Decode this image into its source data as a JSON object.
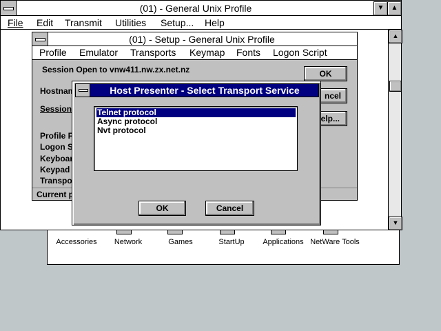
{
  "program_manager": {
    "groups": [
      {
        "label": "Accessories"
      },
      {
        "label": "Network"
      },
      {
        "label": "Games"
      },
      {
        "label": "StartUp"
      },
      {
        "label": "Applications"
      },
      {
        "label": "NetWare Tools"
      }
    ]
  },
  "main_window": {
    "title": "(01) - General Unix Profile",
    "menu": [
      "File",
      "Edit",
      "Transmit",
      "Utilities",
      "Setup...",
      "Help"
    ]
  },
  "setup_window": {
    "title": "(01) - Setup - General Unix Profile",
    "menu": [
      "Profile",
      "Emulator",
      "Transports",
      "Keymap",
      "Fonts",
      "Logon Script"
    ],
    "session_text": "Session Open to vnw411.nw.zx.net.nz",
    "fields": [
      "Hostnam",
      "Session",
      "Profile F",
      "Logon S",
      "Keyboar",
      "Keypad",
      "Transpo"
    ],
    "status": "Current p",
    "buttons": {
      "ok": "OK",
      "cancel": "ncel",
      "help": "elp..."
    }
  },
  "dialog": {
    "title": "Host Presenter - Select Transport Service",
    "options": [
      "Telnet protocol",
      "Async protocol",
      "Nvt protocol"
    ],
    "selected_index": 0,
    "ok_label": "OK",
    "cancel_label": "Cancel"
  },
  "colors": {
    "desktop": "#c0c7c8",
    "active_title": "#000080",
    "window_face": "#c0c0c0"
  }
}
